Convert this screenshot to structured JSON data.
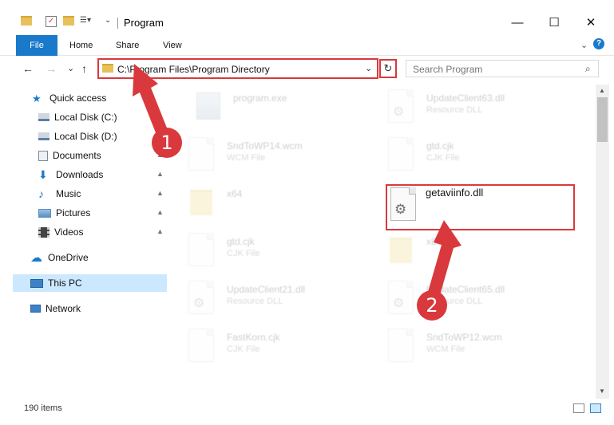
{
  "window": {
    "title": "Program",
    "minimize_glyph": "—",
    "maximize_glyph": "☐",
    "close_glyph": "✕"
  },
  "ribbon": {
    "tabs": [
      "File",
      "Home",
      "Share",
      "View"
    ],
    "expand_glyph": "⌄",
    "help_glyph": "?"
  },
  "nav": {
    "back_glyph": "←",
    "forward_glyph": "→",
    "recent_glyph": "⌄",
    "up_glyph": "↑",
    "address": "C:\\Program Files\\Program Directory",
    "address_dropdown_glyph": "⌄",
    "refresh_glyph": "↻",
    "search_placeholder": "Search Program",
    "search_glyph": "⌕"
  },
  "sidebar": {
    "items": [
      {
        "label": "Quick access",
        "icon": "star-icon",
        "color": "#1979ca"
      },
      {
        "label": "Local Disk (C:)",
        "icon": "drive-icon",
        "color": "#5a7fa8",
        "pinned": true
      },
      {
        "label": "Local Disk (D:)",
        "icon": "drive-icon",
        "color": "#5a7fa8"
      },
      {
        "label": "Documents",
        "icon": "documents-icon",
        "color": "#7a8a99",
        "pinned": true
      },
      {
        "label": "Downloads",
        "icon": "downloads-icon",
        "color": "#1979ca",
        "pinned": true
      },
      {
        "label": "Music",
        "icon": "music-icon",
        "color": "#1979ca",
        "pinned": true
      },
      {
        "label": "Pictures",
        "icon": "pictures-icon",
        "color": "#5a8fc0",
        "pinned": true
      },
      {
        "label": "Videos",
        "icon": "videos-icon",
        "color": "#444444",
        "pinned": true
      },
      {
        "label": "OneDrive",
        "icon": "cloud-icon",
        "color": "#1979ca"
      },
      {
        "label": "This PC",
        "icon": "computer-icon",
        "color": "#3c82c8",
        "selected": true
      },
      {
        "label": "Network",
        "icon": "network-icon",
        "color": "#3c82c8"
      }
    ],
    "pin_glyph": "📌"
  },
  "files": [
    {
      "name": "program.exe",
      "type": "",
      "kind": "exe"
    },
    {
      "name": "UpdateClient63.dll",
      "type": "Resource DLL",
      "kind": "dll"
    },
    {
      "name": "SndToWP14.wcm",
      "type": "WCM File",
      "kind": "doc"
    },
    {
      "name": "gtd.cjk",
      "type": "CJK File",
      "kind": "doc"
    },
    {
      "name": "x64",
      "type": "",
      "kind": "folder"
    },
    {
      "name": "gtd.cjk",
      "type": "CJK File",
      "kind": "doc"
    },
    {
      "name": "x86",
      "type": "",
      "kind": "folder"
    },
    {
      "name": "UpdateClient21.dll",
      "type": "Resource DLL",
      "kind": "dll"
    },
    {
      "name": "UpdateClient65.dll",
      "type": "Resource DLL",
      "kind": "dll"
    },
    {
      "name": "FastKorn.cjk",
      "type": "CJK File",
      "kind": "doc"
    },
    {
      "name": "SndToWP12.wcm",
      "type": "WCM File",
      "kind": "doc"
    }
  ],
  "focus_file": {
    "name": "getaviinfo.dll"
  },
  "status": {
    "items": "190 items"
  },
  "annotations": {
    "callout_1": "1",
    "callout_2": "2",
    "color": "#d9393d"
  }
}
